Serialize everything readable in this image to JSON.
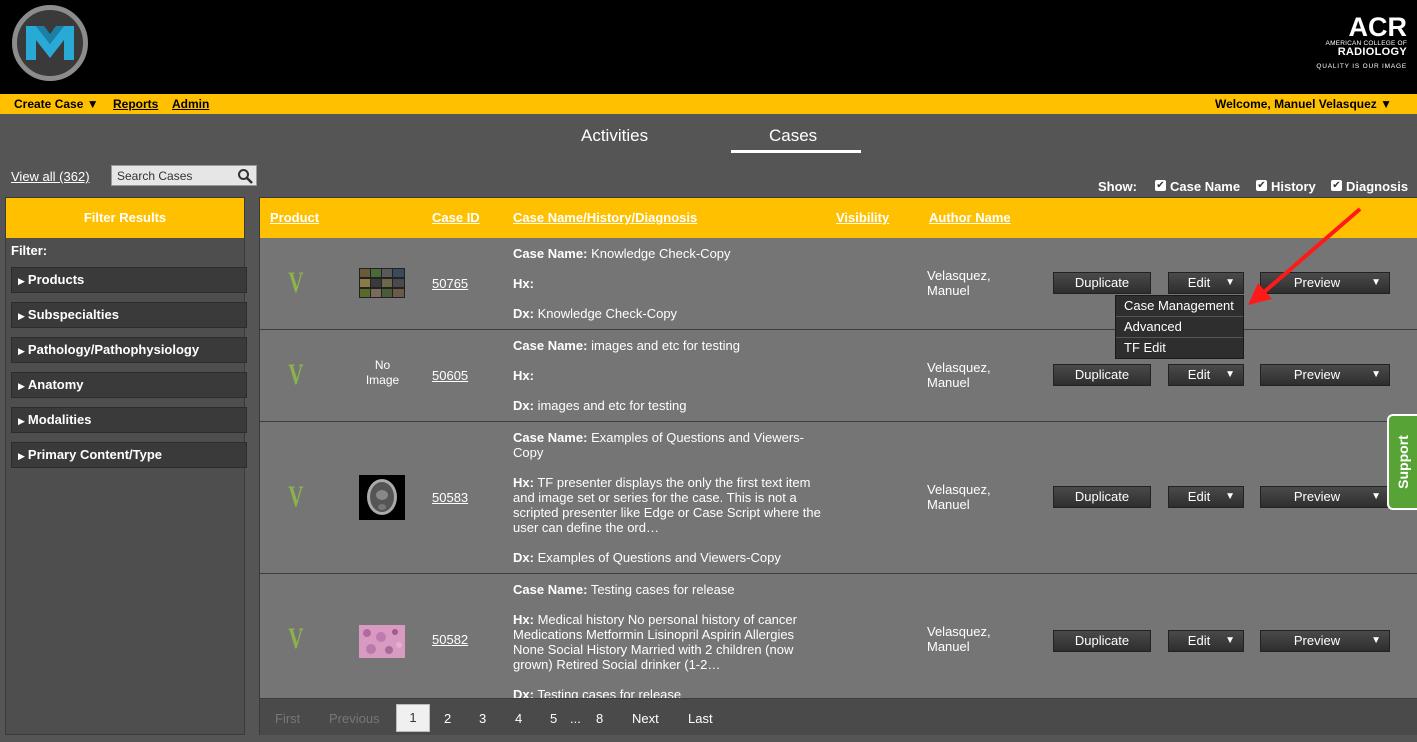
{
  "header": {
    "acr_brand": "ACR",
    "acr_line1": "AMERICAN COLLEGE OF",
    "acr_line2": "RADIOLOGY",
    "acr_tagline": "QUALITY IS OUR IMAGE"
  },
  "topbar": {
    "create_case": "Create Case ▼",
    "reports": "Reports",
    "admin": "Admin",
    "welcome": "Welcome, Manuel Velasquez ▼"
  },
  "tabs": [
    "Activities",
    "Cases"
  ],
  "active_tab": "Cases",
  "toolbar": {
    "view_all": "View all (362)",
    "search_placeholder": "Search Cases",
    "show_label": "Show:",
    "show_options": [
      {
        "label": "Case Name",
        "checked": true
      },
      {
        "label": "History",
        "checked": true
      },
      {
        "label": "Diagnosis",
        "checked": true
      }
    ]
  },
  "filter": {
    "title": "Filter Results",
    "label": "Filter:",
    "facets": [
      "Products",
      "Subspecialties",
      "Pathology/Pathophysiology",
      "Anatomy",
      "Modalities",
      "Primary Content/Type"
    ]
  },
  "table": {
    "columns": [
      "Product",
      "Case ID",
      "Case Name/History/Diagnosis",
      "Visibility",
      "Author Name"
    ],
    "rows": [
      {
        "case_id": "50765",
        "image": "thumbnail-grid",
        "case_name": "Knowledge Check-Copy",
        "hx": "",
        "dx": "Knowledge Check-Copy",
        "author_last": "Velasquez,",
        "author_first": "Manuel"
      },
      {
        "case_id": "50605",
        "image": "none",
        "no_image_line1": "No",
        "no_image_line2": "Image",
        "case_name": "images and etc for testing",
        "hx": "",
        "dx": "images and etc for testing",
        "author_last": "Velasquez,",
        "author_first": "Manuel"
      },
      {
        "case_id": "50583",
        "image": "brain-ct",
        "case_name": "Examples of Questions and Viewers-Copy",
        "hx": "TF presenter displays the only the first text item and image set or series for the case. This is not a scripted presenter like Edge or Case Script where the user can define the ord…",
        "dx": "Examples of Questions and Viewers-Copy",
        "author_last": "Velasquez,",
        "author_first": "Manuel"
      },
      {
        "case_id": "50582",
        "image": "histology",
        "case_name": "Testing cases for release",
        "hx": "Medical history No personal history of cancer Medications Metformin Lisinopril Aspirin Allergies None Social History Married with 2 children (now grown) Retired Social drinker (1-2…",
        "dx": "Testing cases for release",
        "author_last": "Velasquez,",
        "author_first": "Manuel"
      }
    ],
    "labels": {
      "case_name": "Case Name:",
      "hx": "Hx:",
      "dx": "Dx:"
    },
    "actions": {
      "duplicate": "Duplicate",
      "edit": "Edit",
      "preview": "Preview",
      "caret": "▼"
    }
  },
  "edit_menu": [
    "Case Management",
    "Advanced",
    "TF Edit"
  ],
  "pagination": {
    "first": "First",
    "previous": "Previous",
    "current": "1",
    "pages": [
      "2",
      "3",
      "4",
      "5"
    ],
    "ellipsis": "...",
    "last_page": "8",
    "next": "Next",
    "last": "Last"
  },
  "support_tab": "Support",
  "colors": {
    "accent": "#ffc000",
    "background": "#555555",
    "row": "#757575",
    "support": "#58a335",
    "annotation_arrow": "#ff1a1a"
  }
}
